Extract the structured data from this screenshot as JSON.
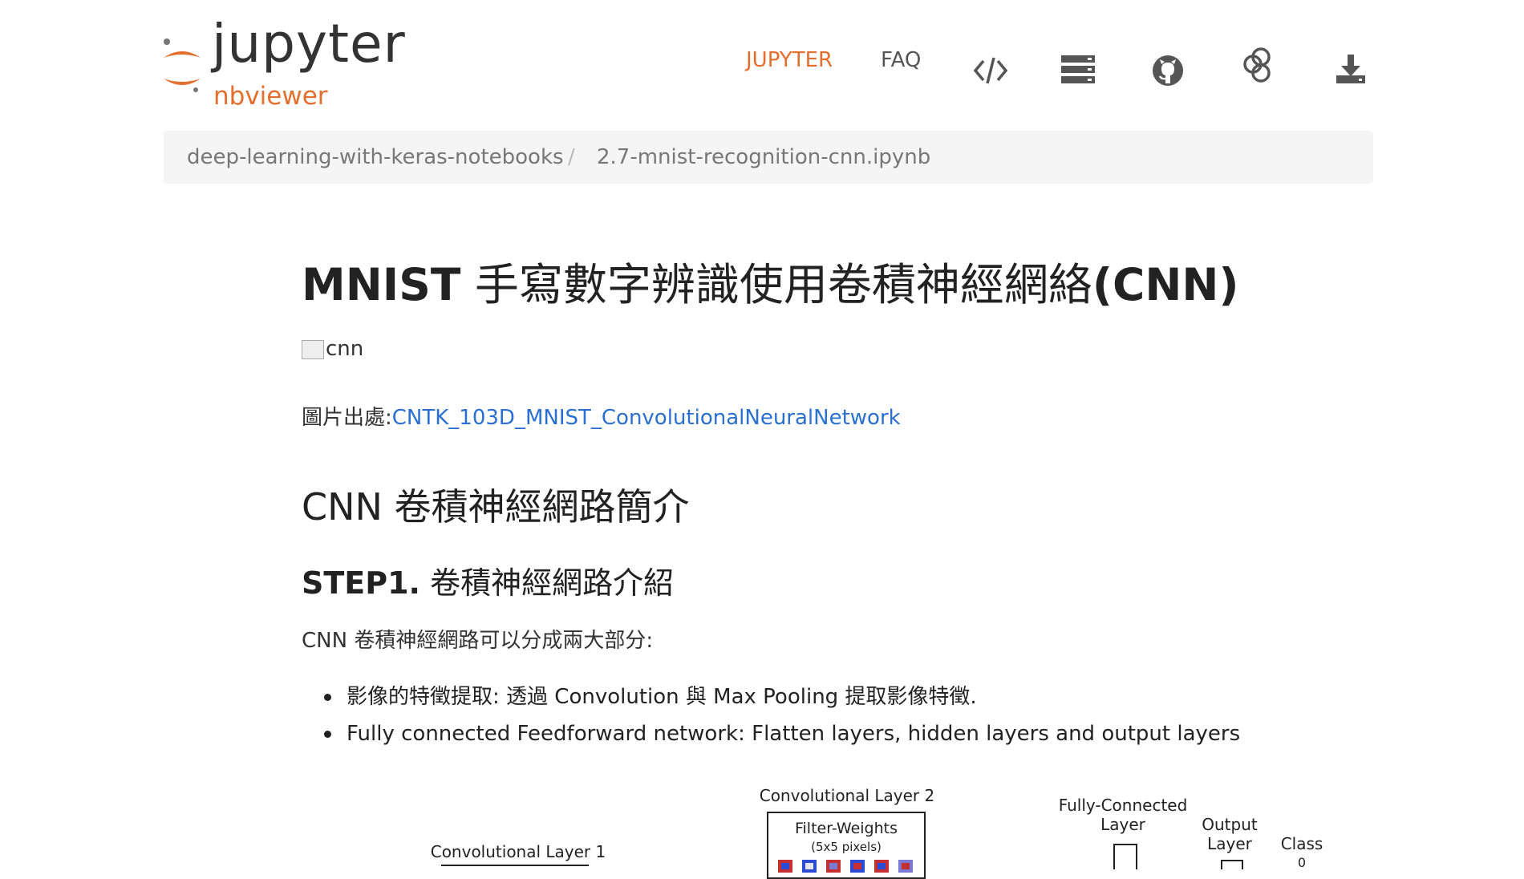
{
  "logo": {
    "wordmark": "jupyter",
    "subtitle": "nbviewer"
  },
  "nav": {
    "jupyter": "JUPYTER",
    "faq": "FAQ",
    "icons": [
      "code-icon",
      "server-icon",
      "github-icon",
      "binder-icon",
      "download-icon"
    ]
  },
  "breadcrumb": {
    "repo": "deep-learning-with-keras-notebooks",
    "separator": "/",
    "file": "2.7-mnist-recognition-cnn.ipynb"
  },
  "content": {
    "title_latin": "MNIST",
    "title_cjk": "手寫數字辨識使用卷積神經網絡",
    "title_suffix": "(CNN)",
    "image_alt": "cnn",
    "source_prefix": "圖片出處:",
    "source_link": "CNTK_103D_MNIST_ConvolutionalNeuralNetwork",
    "h2": "CNN 卷積神經網路簡介",
    "h3_bold": "STEP1.",
    "h3_text": "卷積神經網路介紹",
    "para": "CNN 卷積神經網路可以分成兩大部分:",
    "bullets": [
      "影像的特徵提取: 透過 Convolution 與 Max Pooling 提取影像特徵.",
      "Fully connected Feedforward network: Flatten layers, hidden layers and output layers"
    ]
  },
  "figure": {
    "conv2_title": "Convolutional Layer 2",
    "filter_weights": "Filter-Weights",
    "filter_size": "(5x5 pixels)",
    "conv1_title": "Convolutional Layer 1",
    "fc_title": "Fully-Connected Layer",
    "fc_line1": "Fully-Connected",
    "fc_line2": "Layer",
    "output_line1": "Output",
    "output_line2": "Layer",
    "class_label": "Class",
    "class_value": "0"
  },
  "colors": {
    "accent": "#e46e2e",
    "link": "#2a6fd1",
    "breadcrumb_bg": "#f5f5f5"
  }
}
